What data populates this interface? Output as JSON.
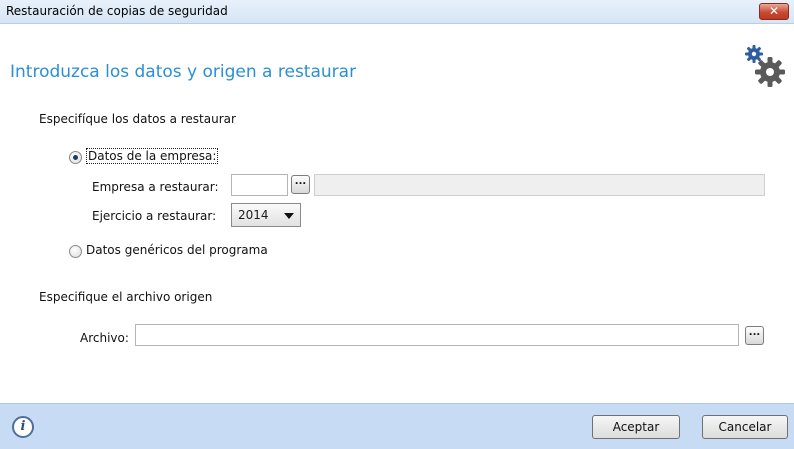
{
  "window": {
    "title": "Restauración de copias de seguridad",
    "close_glyph": "✕"
  },
  "header": {
    "title": "Introduzca los datos y origen a restaurar",
    "icon": "gears-icon"
  },
  "data_section": {
    "title": "Especifíque los datos a restaurar",
    "option_company": {
      "label": "Datos de la empresa:",
      "checked": true
    },
    "company_field": {
      "label": "Empresa a restaurar:",
      "value": "",
      "browse_label": "...",
      "description": ""
    },
    "year_field": {
      "label": "Ejercicio a restaurar:",
      "value": "2014"
    },
    "option_generic": {
      "label": "Datos genéricos del programa",
      "checked": false
    }
  },
  "source_section": {
    "title": "Especifique el archivo origen",
    "file_field": {
      "label": "Archivo:",
      "value": "",
      "browse_label": "..."
    }
  },
  "footer": {
    "info_glyph": "i",
    "accept_label": "Aceptar",
    "cancel_label": "Cancelar"
  }
}
